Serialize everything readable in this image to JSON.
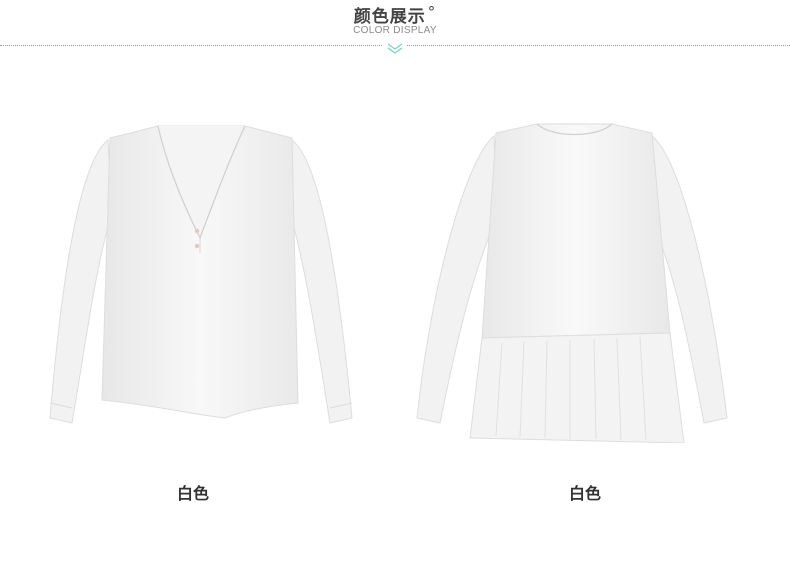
{
  "header": {
    "title": "颜色展示",
    "title_suffix": "°",
    "subtitle": "COLOR DISPLAY"
  },
  "products": [
    {
      "view": "front",
      "color_label": "白色"
    },
    {
      "view": "back",
      "color_label": "白色"
    }
  ],
  "colors": {
    "accent": "#7fcfc7",
    "text": "#333333",
    "divider": "#9a9a9a"
  }
}
